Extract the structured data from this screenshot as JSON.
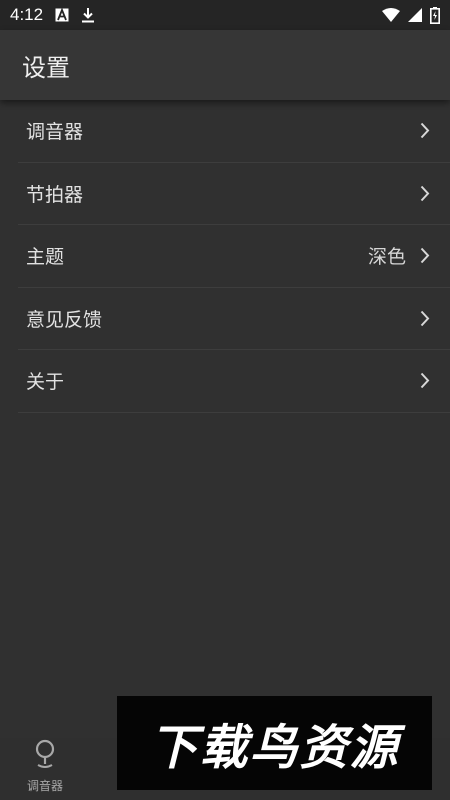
{
  "status_bar": {
    "time": "4:12",
    "left_icons": [
      "notification-a-icon",
      "download-icon"
    ],
    "right_icons": [
      "wifi-icon",
      "signal-icon",
      "battery-charging-icon"
    ]
  },
  "app_bar": {
    "title": "设置"
  },
  "settings": {
    "items": [
      {
        "label": "调音器",
        "value": ""
      },
      {
        "label": "节拍器",
        "value": ""
      },
      {
        "label": "主题",
        "value": "深色"
      },
      {
        "label": "意见反馈",
        "value": ""
      },
      {
        "label": "关于",
        "value": ""
      }
    ]
  },
  "bottom_nav": {
    "items": [
      {
        "label": "调音器",
        "icon": "tuner-pin-icon"
      },
      {
        "label": "",
        "icon": ""
      },
      {
        "label": "",
        "icon": ""
      },
      {
        "label": "",
        "icon": ""
      },
      {
        "label": "",
        "icon": ""
      }
    ],
    "active_color": "#3fc6a4"
  },
  "watermark": {
    "text": "下载鸟资源"
  },
  "colors": {
    "background": "#303030",
    "app_bar": "#363636",
    "status_bar": "#252525",
    "accent": "#3fc6a4"
  }
}
